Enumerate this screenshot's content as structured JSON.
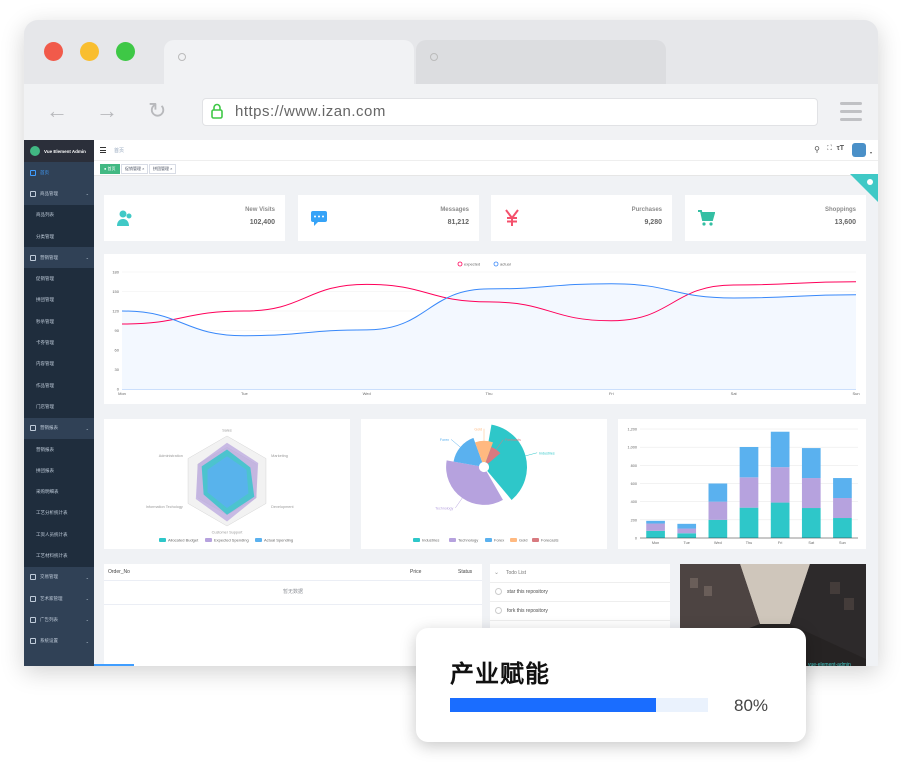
{
  "browser": {
    "url": "https://www.izan.com",
    "colors": {
      "close": "#f15a4a",
      "min": "#f9be2f",
      "max": "#3ec846"
    }
  },
  "sidebar": {
    "title": "Vue Element Admin",
    "items": [
      {
        "label": "首页",
        "type": "active"
      },
      {
        "label": "商品管理",
        "type": "group"
      },
      {
        "label": "商品列表",
        "type": "sub"
      },
      {
        "label": "分类管理",
        "type": "sub"
      },
      {
        "label": "营销管理",
        "type": "group"
      },
      {
        "label": "促销管理",
        "type": "sub"
      },
      {
        "label": "拼团管理",
        "type": "sub"
      },
      {
        "label": "秒杀管理",
        "type": "sub"
      },
      {
        "label": "卡券管理",
        "type": "sub"
      },
      {
        "label": "内容管理",
        "type": "sub"
      },
      {
        "label": "作品管理",
        "type": "sub"
      },
      {
        "label": "门店管理",
        "type": "sub"
      },
      {
        "label": "营销报表",
        "type": "group"
      },
      {
        "label": "营销报表",
        "type": "sub"
      },
      {
        "label": "拼团报表",
        "type": "sub"
      },
      {
        "label": "采购明细表",
        "type": "sub"
      },
      {
        "label": "工艺分析统计表",
        "type": "sub"
      },
      {
        "label": "工资人员统计表",
        "type": "sub"
      },
      {
        "label": "工艺材料统计表",
        "type": "sub"
      },
      {
        "label": "交易管理",
        "type": "group"
      },
      {
        "label": "艺术家管理",
        "type": "group"
      },
      {
        "label": "广告列表",
        "type": "group"
      },
      {
        "label": "系统设置",
        "type": "group"
      }
    ]
  },
  "header": {
    "breadcrumb": "首页"
  },
  "tags": [
    "首页",
    "促销管理",
    "拼团管理"
  ],
  "stats": [
    {
      "label": "New Visits",
      "value": "102,400",
      "icon": "people-icon",
      "color": "#40c9c6"
    },
    {
      "label": "Messages",
      "value": "81,212",
      "icon": "message-icon",
      "color": "#36a3f7"
    },
    {
      "label": "Purchases",
      "value": "9,280",
      "icon": "yen-icon",
      "color": "#f4516c"
    },
    {
      "label": "Shoppings",
      "value": "13,600",
      "icon": "cart-icon",
      "color": "#34bfa3"
    }
  ],
  "chart_data": [
    {
      "type": "line",
      "legend": [
        "expected",
        "actual"
      ],
      "legend_position": "top-center",
      "categories": [
        "Mon",
        "Tue",
        "Wed",
        "Thu",
        "Fri",
        "Sat",
        "Sun"
      ],
      "series": [
        {
          "name": "expected",
          "values": [
            100,
            120,
            161,
            134,
            105,
            160,
            165
          ],
          "color": "#ff005a"
        },
        {
          "name": "actual",
          "values": [
            120,
            82,
            91,
            154,
            162,
            140,
            145
          ],
          "color": "#3888fa"
        }
      ],
      "ylim": [
        0,
        180
      ],
      "yticks": [
        0,
        30,
        60,
        90,
        120,
        150,
        180
      ]
    },
    {
      "type": "radar",
      "indicators": [
        "Sales",
        "Marketing",
        "Development",
        "Customer Support",
        "Information Techology",
        "Administration"
      ],
      "legend": [
        "Allocated Budget",
        "Expected Spending",
        "Actual Spending"
      ],
      "legend_position": "bottom",
      "colors": [
        "#2ec7c9",
        "#b6a2de",
        "#5ab1ef"
      ]
    },
    {
      "type": "pie",
      "categories": [
        "Industries",
        "Technology",
        "Forex",
        "Gold",
        "Forecasts"
      ],
      "values": [
        320,
        240,
        149,
        100,
        59
      ],
      "colors": [
        "#2ec7c9",
        "#b6a2de",
        "#5ab1ef",
        "#ffb980",
        "#d87a80"
      ],
      "legend_position": "bottom"
    },
    {
      "type": "bar",
      "stacked": true,
      "categories": [
        "Mon",
        "Tue",
        "Wed",
        "Thu",
        "Fri",
        "Sat",
        "Sun"
      ],
      "series": [
        {
          "name": "pageA",
          "values": [
            79,
            52,
            200,
            334,
            390,
            330,
            220
          ],
          "color": "#2ec7c9"
        },
        {
          "name": "pageB",
          "values": [
            80,
            52,
            200,
            334,
            390,
            330,
            220
          ],
          "color": "#b6a2de"
        },
        {
          "name": "pageC",
          "values": [
            30,
            52,
            200,
            334,
            390,
            330,
            220
          ],
          "color": "#5ab1ef"
        }
      ],
      "ylim": [
        0,
        1200
      ],
      "yticks": [
        "0",
        "200",
        "400",
        "600",
        "800",
        "1,000",
        "1,200"
      ]
    }
  ],
  "table": {
    "headers": [
      "Order_No",
      "Price",
      "Status"
    ],
    "empty": "暂无数据"
  },
  "todo": {
    "title": "Todo List",
    "items": [
      "star this repository",
      "fork this repository"
    ]
  },
  "photo_caption": "vue-element-admin",
  "overlay": {
    "title": "产业赋能",
    "progress": 0.8,
    "percent_text": "80%"
  }
}
